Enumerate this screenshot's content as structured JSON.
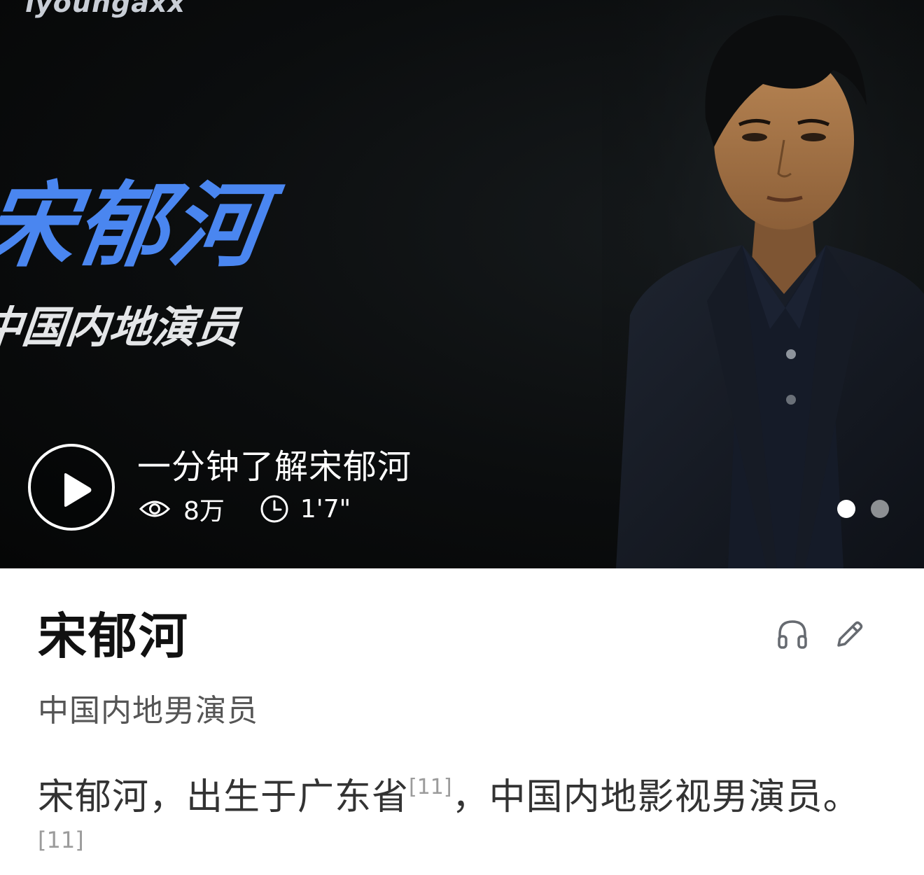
{
  "banner": {
    "brand_text": "iyoungaxx",
    "big_title": "宋郁河",
    "big_subtitle": "中国内地演员",
    "video_title": "一分钟了解宋郁河",
    "views": "8万",
    "duration": "1'7\"",
    "carousel": {
      "total": 2,
      "active": 1
    },
    "accent_color": "#4a86f0"
  },
  "icons": {
    "play": "play-icon",
    "views": "eye-icon",
    "duration": "clock-icon",
    "listen": "headphones-icon",
    "edit": "pencil-icon"
  },
  "entry": {
    "title": "宋郁河",
    "subtitle": "中国内地男演员",
    "summary_part1": "宋郁河，出生于广东省",
    "summary_ref1": "[11]",
    "summary_part2": "，中国内地影视男演员。",
    "summary_ref2": "[11]"
  }
}
